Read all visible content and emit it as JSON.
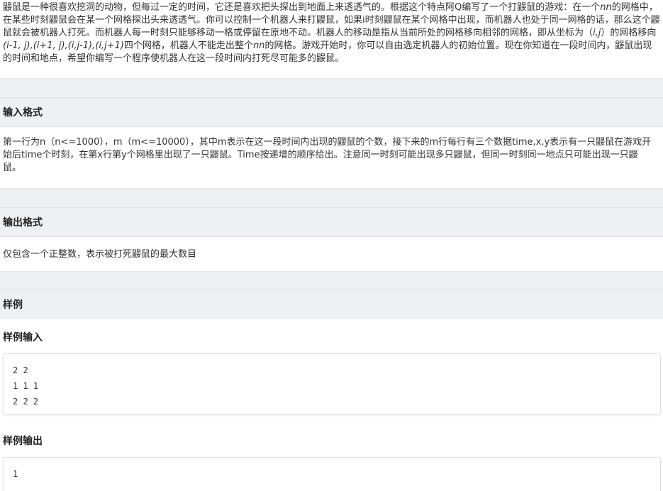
{
  "description": {
    "part1": "鼹鼠是一种很喜欢挖洞的动物，但每过一定的时间，它还是喜欢把头探出到地面上来透透气的。根据这个特点阿Q编写了一个打鼹鼠的游戏：在一个",
    "nn1": "nn",
    "part2": "的网格中，在某些时刻鼹鼠会在某一个网格探出头来透透气。你可以控制一个机器人来打鼹鼠，如果i时刻鼹鼠在某个网格中出现，而机器人也处于同一网格的话，那么这个鼹鼠就会被机器人打死。而机器人每一时刻只能够移动一格或停留在原地不动。机器人的移动是指从当前所处的网格移向相邻的网格，即从坐标为（",
    "ij": "i,j",
    "part3": "）的网格移向",
    "moves": "(i-1, j),(i+1, j),(i,j-1),(i,j+1)",
    "part4": "四个网格，机器人不能走出整个",
    "nn2": "nn",
    "part5": "的网格。游戏开始时，你可以自由选定机器人的初始位置。现在你知道在一段时间内，鼹鼠出现的时间和地点，希望你编写一个程序使机器人在这一段时间内打死尽可能多的鼹鼠。"
  },
  "input_section": {
    "title": "输入格式",
    "text": "第一行为n（n<=1000），m（m<=10000），其中m表示在这一段时间内出现的鼹鼠的个数，接下来的m行每行有三个数据time,x,y表示有一只鼹鼠在游戏开始后time个时刻，在第x行第y个网格里出现了一只鼹鼠。Time按递增的顺序给出。注意同一时刻可能出现多只鼹鼠，但同一时刻同一地点只可能出现一只鼹鼠。"
  },
  "output_section": {
    "title": "输出格式",
    "text": "仅包含一个正整数，表示被打死鼹鼠的最大数目"
  },
  "sample_section": {
    "title": "样例",
    "input_title": "样例输入",
    "input_lines": [
      "2 2",
      "1 1 1",
      "2 2 2"
    ],
    "output_title": "样例输出",
    "output_lines": [
      "1"
    ]
  }
}
